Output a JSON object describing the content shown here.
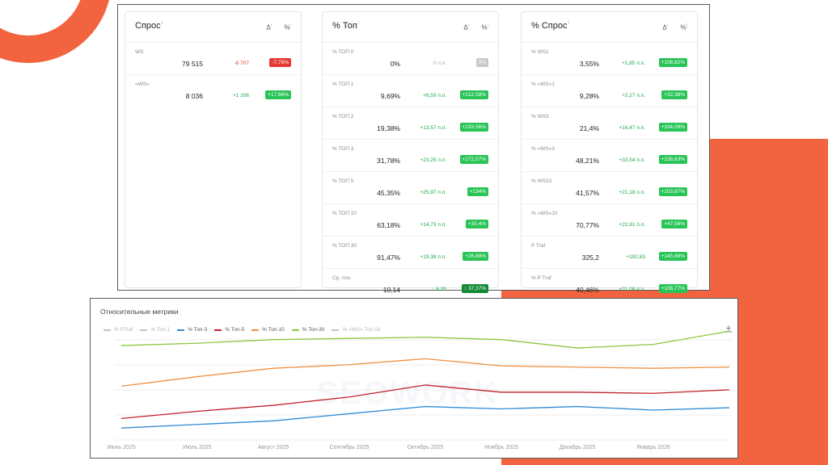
{
  "cards": [
    {
      "title": "Спрос",
      "delta_head": "Δ",
      "pct_head": "%",
      "info": "i",
      "rows": [
        {
          "label": "WS",
          "value": "79 515",
          "delta": "-6 707",
          "badge": "-7,78%",
          "delta_color": "#e53935",
          "badge_color": "#e53935"
        },
        {
          "label": "«WS»",
          "value": "8 036",
          "delta": "+1 206",
          "badge": "+17,66%",
          "delta_color": "#1fa84a",
          "badge_color": "#28c456"
        }
      ]
    },
    {
      "title": "% Топ",
      "delta_head": "Δ",
      "pct_head": "%",
      "info": "i",
      "rows": [
        {
          "label": "% ТОП 0",
          "value": "0%",
          "delta": "0 п.п.",
          "badge": "0%",
          "delta_color": "#aaaaaa",
          "badge_color": "#c8c8c8"
        },
        {
          "label": "% ТОП 1",
          "value": "9,69%",
          "delta": "+6,59 п.п.",
          "badge": "+212,58%",
          "delta_color": "#1fa84a",
          "badge_color": "#28c456"
        },
        {
          "label": "% ТОП 2",
          "value": "19,38%",
          "delta": "+13,57 п.п.",
          "badge": "+233,56%",
          "delta_color": "#1fa84a",
          "badge_color": "#28c456"
        },
        {
          "label": "% ТОП 3",
          "value": "31,78%",
          "delta": "+23,25 п.п.",
          "badge": "+272,57%",
          "delta_color": "#1fa84a",
          "badge_color": "#28c456"
        },
        {
          "label": "% ТОП 5",
          "value": "45,35%",
          "delta": "+25,97 п.п.",
          "badge": "+134%",
          "delta_color": "#1fa84a",
          "badge_color": "#28c456"
        },
        {
          "label": "% ТОП 10",
          "value": "63,18%",
          "delta": "+14,73 п.п.",
          "badge": "+30,4%",
          "delta_color": "#1fa84a",
          "badge_color": "#28c456"
        },
        {
          "label": "% ТОП 30",
          "value": "91,47%",
          "delta": "+19,38 п.п.",
          "badge": "+26,88%",
          "delta_color": "#1fa84a",
          "badge_color": "#28c456"
        },
        {
          "label": "Ср. поз.",
          "value": "10,14",
          "delta": "↑ 6,05",
          "badge": "↑ 37,37%",
          "delta_color": "#1fa84a",
          "badge_color": "#138a36"
        }
      ]
    },
    {
      "title": "% Спрос",
      "delta_head": "Δ",
      "pct_head": "%",
      "info": "i",
      "rows": [
        {
          "label": "% WS1",
          "value": "3,55%",
          "delta": "+1,85 п.п.",
          "badge": "+108,82%",
          "delta_color": "#1fa84a",
          "badge_color": "#28c456"
        },
        {
          "label": "% «WS»1",
          "value": "9,28%",
          "delta": "+2,27 п.п.",
          "badge": "+32,38%",
          "delta_color": "#1fa84a",
          "badge_color": "#28c456"
        },
        {
          "label": "% WS3",
          "value": "21,4%",
          "delta": "+16,47 п.п.",
          "badge": "+334,08%",
          "delta_color": "#1fa84a",
          "badge_color": "#28c456"
        },
        {
          "label": "% «WS»3",
          "value": "48,21%",
          "delta": "+33,54 п.п.",
          "badge": "+228,63%",
          "delta_color": "#1fa84a",
          "badge_color": "#28c456"
        },
        {
          "label": "% WS10",
          "value": "41,57%",
          "delta": "+21,18 п.п.",
          "badge": "+103,87%",
          "delta_color": "#1fa84a",
          "badge_color": "#28c456"
        },
        {
          "label": "% «WS»10",
          "value": "70,77%",
          "delta": "+22,81 п.п.",
          "badge": "+47,56%",
          "delta_color": "#1fa84a",
          "badge_color": "#28c456"
        },
        {
          "label": "P Traf",
          "value": "325,2",
          "delta": "+192,83",
          "badge": "+145,68%",
          "delta_color": "#1fa84a",
          "badge_color": "#28c456"
        },
        {
          "label": "% P Traf",
          "value": "40,46%",
          "delta": "+21,08 п.п.",
          "badge": "+108,77%",
          "delta_color": "#1fa84a",
          "badge_color": "#28c456"
        }
      ]
    }
  ],
  "chart_panel": {
    "title": "Относительные метрики",
    "watermark": "SEOWORK",
    "download_icon": "download-icon"
  },
  "chart_data": {
    "type": "line",
    "title": "Относительные метрики",
    "categories": [
      "Июнь 2025",
      "Июль 2025",
      "Август 2025",
      "Сентябрь 2025",
      "Октябрь 2025",
      "Ноябрь 2025",
      "Декабрь 2025",
      "Январь 2026"
    ],
    "x_points": 9,
    "grid": true,
    "legend_position": "top-left",
    "series": [
      {
        "name": "% PTraf",
        "color": "#c4c4c4",
        "visible": false,
        "values": []
      },
      {
        "name": "% Топ-1",
        "color": "#c4c4c4",
        "visible": false,
        "values": []
      },
      {
        "name": "% Топ-3",
        "color": "#2e8bd6",
        "visible": true,
        "values": [
          10,
          13,
          16,
          22,
          28,
          26,
          28,
          25,
          27
        ]
      },
      {
        "name": "% Топ-5",
        "color": "#c0202a",
        "visible": true,
        "values": [
          18,
          24,
          29,
          36,
          46,
          40,
          40,
          39,
          42
        ]
      },
      {
        "name": "% Топ-10",
        "color": "#ef8f40",
        "visible": true,
        "values": [
          45,
          53,
          60,
          63,
          68,
          62,
          61,
          60,
          61
        ]
      },
      {
        "name": "% Топ-30",
        "color": "#8cc63f",
        "visible": true,
        "values": [
          79,
          81,
          84,
          85,
          86,
          84,
          77,
          80,
          91
        ]
      },
      {
        "name": "% «WS» Топ-10",
        "color": "#c4c4c4",
        "visible": false,
        "values": []
      }
    ],
    "ylim": [
      0,
      100
    ]
  }
}
